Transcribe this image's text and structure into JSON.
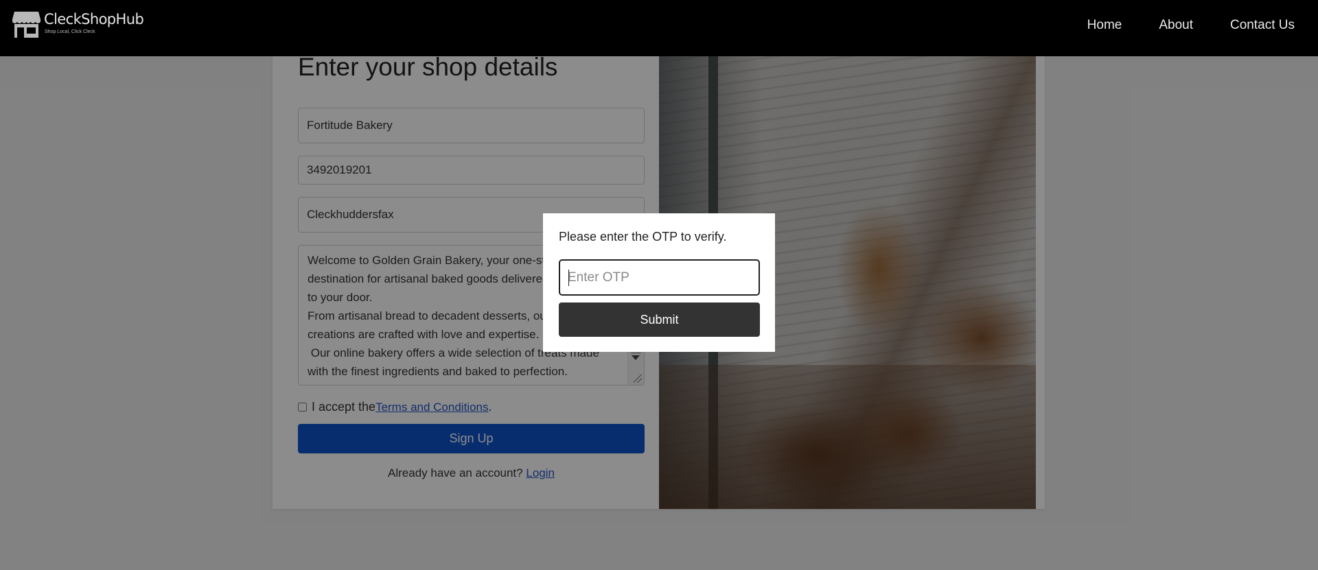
{
  "brand": {
    "name": "CleckShopHub",
    "tagline": "Shop Local, Click Cleck"
  },
  "nav": {
    "items": [
      "Home",
      "About",
      "Contact Us"
    ]
  },
  "form": {
    "title": "Enter your shop details",
    "shop_name": "Fortitude Bakery",
    "phone": "3492019201",
    "location": "Cleckhuddersfax",
    "description": "Welcome to Golden Grain Bakery, your one-stop\ndestination for artisanal baked goods delivered right\nto your door.\nFrom artisanal bread to decadent desserts, our\ncreations are crafted with love and expertise.\n Our online bakery offers a wide selection of treats made\nwith the finest ingredients and baked to perfection.\nOrder now and let the aroma of our freshly baked",
    "terms_prefix": "I accept the",
    "terms_link": "Terms and Conditions",
    "terms_suffix": ".",
    "signup_label": "Sign Up",
    "login_prompt": "Already have an account?",
    "login_link": "Login"
  },
  "modal": {
    "message": "Please enter the OTP to verify.",
    "otp_placeholder": "Enter OTP",
    "submit_label": "Submit"
  }
}
